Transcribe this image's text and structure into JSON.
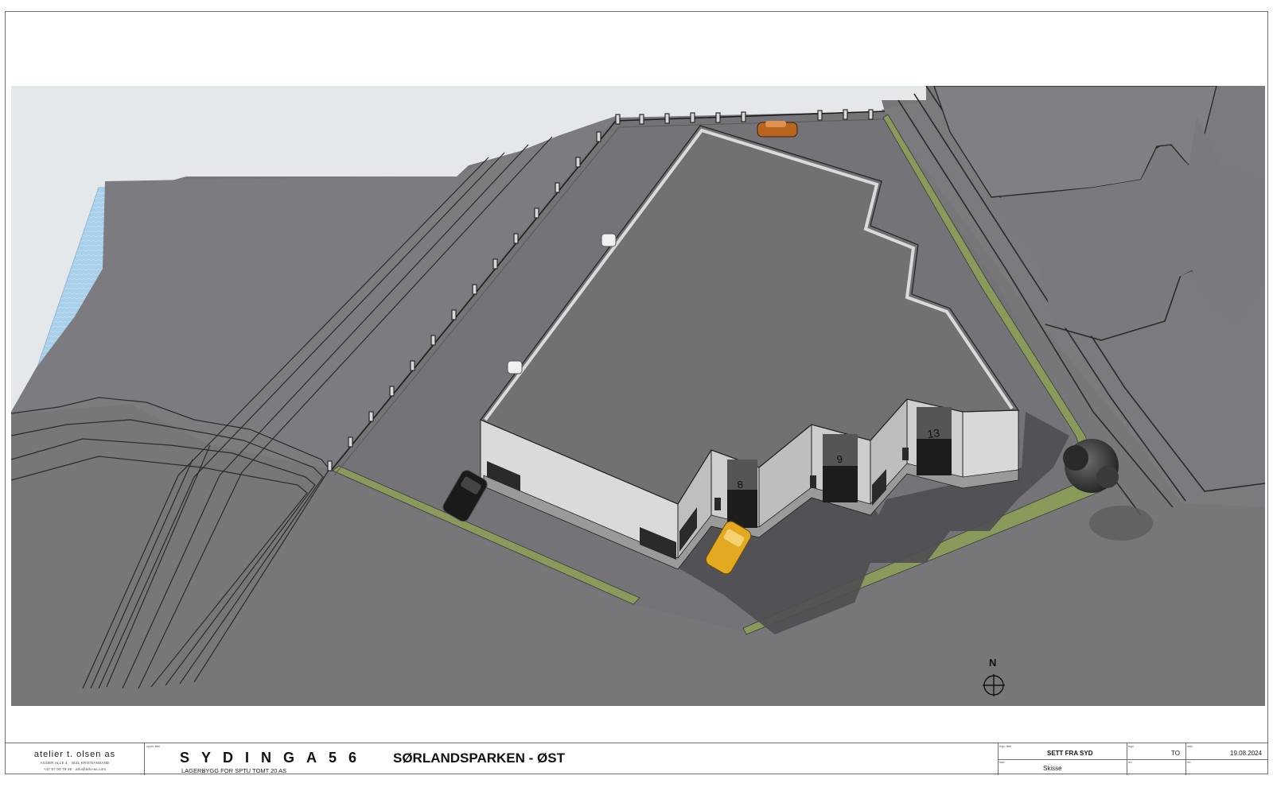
{
  "drawing": {
    "compass_label": "N",
    "units": [
      {
        "label": "8"
      },
      {
        "label": "9"
      },
      {
        "label": "13"
      }
    ]
  },
  "titleblock": {
    "firm": {
      "name": "atelier t. olsen as",
      "address": "AGDER ALLE 4 · 4631 KRISTIANSAND",
      "contact": "+47 97 00 78 26 · atlo@atlo-as.com"
    },
    "project": {
      "title": "SYDINGA56",
      "subtitle": "SØRLANDSPARKEN - ØST",
      "description": "LAGERBYGG FOR SPTU TOMT 20 AS"
    },
    "labels": {
      "project": "oppdr. tittel",
      "drawing": "tegn. tittel",
      "type": "fase",
      "by": "tegn",
      "date": "dato",
      "rev": "rev"
    },
    "drawing_title": "SETT FRA SYD",
    "drawing_type": "Skisse",
    "drawn_by": "TO",
    "date": "19.08.2024"
  },
  "colors": {
    "terrain": "#77777a",
    "roof": "#717174",
    "wall": "#dcdcdc",
    "sky": "#e6e9ec",
    "water": "#a9d0ea",
    "grass": "#8a9a5b"
  }
}
